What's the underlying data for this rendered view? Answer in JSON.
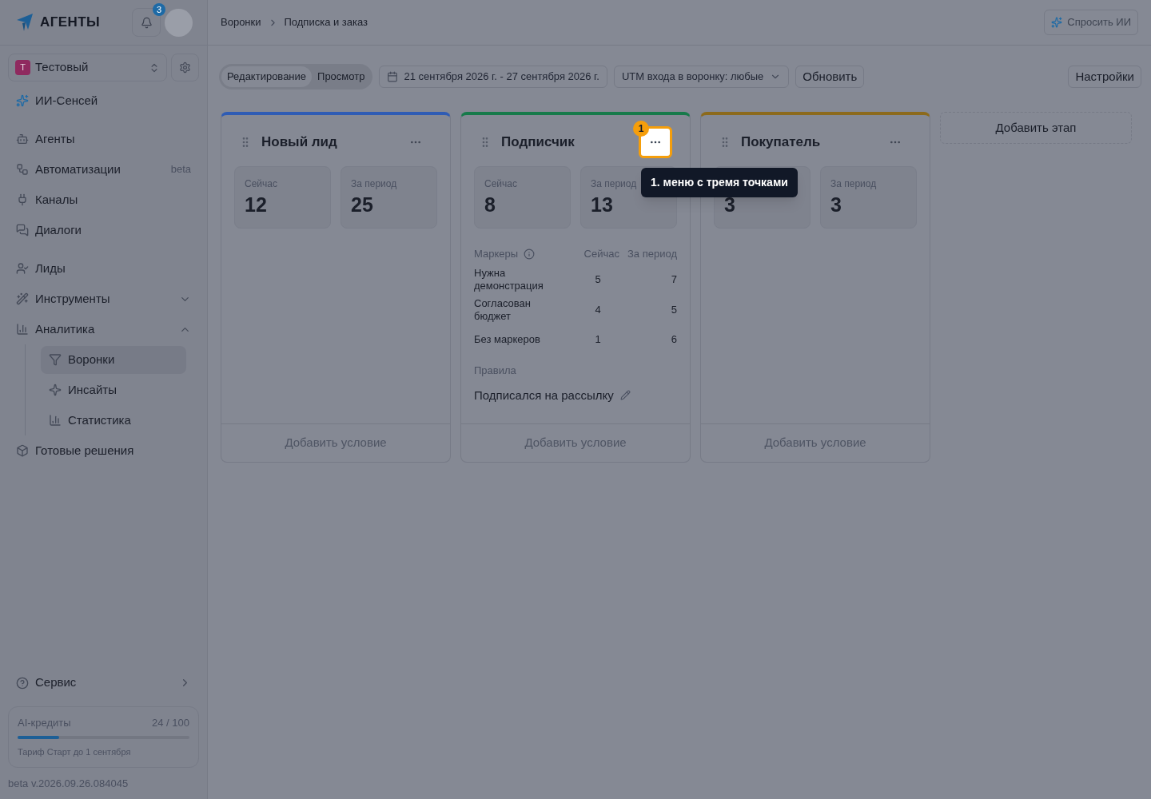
{
  "logo": {
    "text": "АГЕНТЫ"
  },
  "notifications": {
    "count": "3"
  },
  "workspace": {
    "initial": "Т",
    "name": "Тестовый"
  },
  "sidebar": {
    "sections": [
      {
        "items": [
          {
            "label": "ИИ-Сенсей",
            "kind": "accent"
          }
        ]
      },
      {
        "items": [
          {
            "label": "Агенты",
            "kind": "item"
          },
          {
            "label": "Автоматизации",
            "kind": "item",
            "badge": "beta"
          },
          {
            "label": "Каналы",
            "kind": "item"
          },
          {
            "label": "Диалоги",
            "kind": "item"
          }
        ]
      },
      {
        "items": [
          {
            "label": "Лиды",
            "kind": "item"
          },
          {
            "label": "Инструменты",
            "kind": "group",
            "expanded": false
          },
          {
            "label": "Аналитика",
            "kind": "group",
            "expanded": true,
            "children": [
              {
                "label": "Воронки",
                "selected": true
              },
              {
                "label": "Инсайты",
                "selected": false
              },
              {
                "label": "Статистика",
                "selected": false
              }
            ]
          },
          {
            "label": "Готовые решения",
            "kind": "item"
          }
        ]
      }
    ]
  },
  "service": {
    "label": "Сервис"
  },
  "credits": {
    "label": "AI-кредиты",
    "reading": "24 / 100",
    "level": 0.24,
    "plan": "Тариф Старт до 1 сентября"
  },
  "version": "beta v.2026.09.26.084045",
  "breadcrumbs": [
    "Воронки",
    "Подписка и заказ"
  ],
  "ask_ai": "Спросить ИИ",
  "toolbar": {
    "mode_tabs": [
      {
        "label": "Редактирование",
        "selected": true
      },
      {
        "label": "Просмотр",
        "selected": false
      }
    ],
    "date_range": "21 сентября 2026 г. - 27 сентября 2026 г.",
    "utm_filter": "UTM входа в воронку: любые",
    "refresh": "Обновить",
    "settings": "Настройки"
  },
  "stages": [
    {
      "title": "Новый лид",
      "color": "#2f5cb4",
      "menu_highlighted": false,
      "stats": [
        {
          "label": "Сейчас",
          "value": "12"
        },
        {
          "label": "За период",
          "value": "25"
        }
      ],
      "add_condition": "Добавить условие"
    },
    {
      "title": "Подписчик",
      "color": "#177a4a",
      "menu_highlighted": true,
      "stats": [
        {
          "label": "Сейчас",
          "value": "8"
        },
        {
          "label": "За период",
          "value": "13"
        }
      ],
      "markers": {
        "columns": [
          "Маркеры",
          "Сейчас",
          "За период"
        ],
        "rows": [
          {
            "name": "Нужна демонстрация",
            "now": "5",
            "period": "7"
          },
          {
            "name": "Согласован бюджет",
            "now": "4",
            "period": "5"
          },
          {
            "name": "Без маркеров",
            "now": "1",
            "period": "6"
          }
        ]
      },
      "rules": {
        "label": "Правила",
        "items": [
          "Подписался на рассылку"
        ]
      },
      "add_condition": "Добавить условие"
    },
    {
      "title": "Покупатель",
      "color": "#8c6a1c",
      "menu_highlighted": false,
      "stats": [
        {
          "value": "3"
        },
        {
          "label": "За период",
          "value": "3"
        }
      ],
      "add_condition": "Добавить условие"
    }
  ],
  "add_stage": "Добавить этап",
  "tour": {
    "step": "1",
    "text": "1. меню с тремя точками"
  }
}
